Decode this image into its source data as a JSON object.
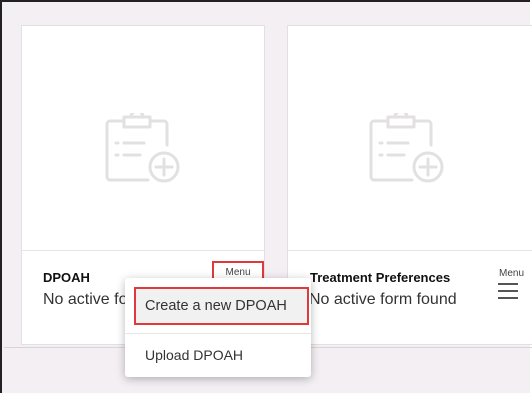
{
  "cards": [
    {
      "title": "DPOAH",
      "status": "No active form found",
      "menu_label": "Menu",
      "icon": "clipboard-add-icon"
    },
    {
      "title": "Treatment Preferences",
      "status": "No active form found",
      "menu_label": "Menu",
      "icon": "clipboard-add-icon"
    }
  ],
  "dropdown": {
    "items": [
      {
        "label": "Create a new DPOAH",
        "highlighted": true
      },
      {
        "label": "Upload DPOAH"
      }
    ]
  },
  "colors": {
    "background": "#f3eff2",
    "card": "#ffffff",
    "highlight_outline": "#e0393b",
    "icon": "#e3e0e2"
  }
}
